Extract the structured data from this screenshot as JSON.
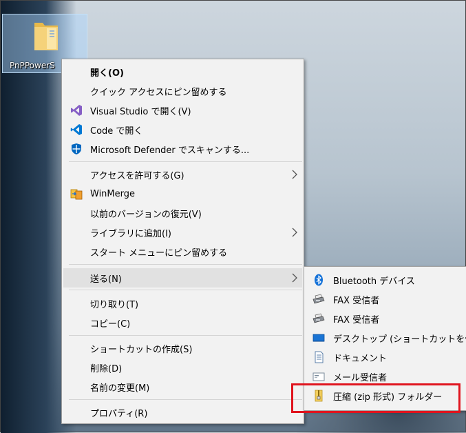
{
  "desktop": {
    "icon_label": "PnPPowerS"
  },
  "context_menu": {
    "items": [
      {
        "label": "開く(O)",
        "icon": "none"
      },
      {
        "label": "クイック アクセスにピン留めする",
        "icon": "none"
      },
      {
        "label": "Visual Studio で開く(V)",
        "icon": "visual-studio-icon"
      },
      {
        "label": "Code で開く",
        "icon": "vscode-icon"
      },
      {
        "label": "Microsoft Defender でスキャンする...",
        "icon": "defender-shield-icon"
      },
      {
        "label": "アクセスを許可する(G)",
        "icon": "none",
        "submenu": true
      },
      {
        "label": "WinMerge",
        "icon": "winmerge-icon"
      },
      {
        "label": "以前のバージョンの復元(V)",
        "icon": "none"
      },
      {
        "label": "ライブラリに追加(I)",
        "icon": "none",
        "submenu": true
      },
      {
        "label": "スタート メニューにピン留めする",
        "icon": "none"
      },
      {
        "label": "送る(N)",
        "icon": "none",
        "submenu": true,
        "highlighted": true
      },
      {
        "label": "切り取り(T)",
        "icon": "none"
      },
      {
        "label": "コピー(C)",
        "icon": "none"
      },
      {
        "label": "ショートカットの作成(S)",
        "icon": "none"
      },
      {
        "label": "削除(D)",
        "icon": "none"
      },
      {
        "label": "名前の変更(M)",
        "icon": "none"
      },
      {
        "label": "プロパティ(R)",
        "icon": "none"
      }
    ]
  },
  "send_to_menu": {
    "items": [
      {
        "label": "Bluetooth デバイス",
        "icon": "bluetooth-icon"
      },
      {
        "label": "FAX 受信者",
        "icon": "fax-icon"
      },
      {
        "label": "FAX 受信者",
        "icon": "fax-icon"
      },
      {
        "label": "デスクトップ (ショートカットを作成)",
        "icon": "desktop-icon"
      },
      {
        "label": "ドキュメント",
        "icon": "document-icon"
      },
      {
        "label": "メール受信者",
        "icon": "mail-icon"
      },
      {
        "label": "圧縮 (zip 形式) フォルダー",
        "icon": "zip-folder-icon",
        "highlighted": true
      }
    ]
  },
  "colors": {
    "highlight_box": "#e0141e",
    "menu_bg": "#f2f2f2"
  }
}
